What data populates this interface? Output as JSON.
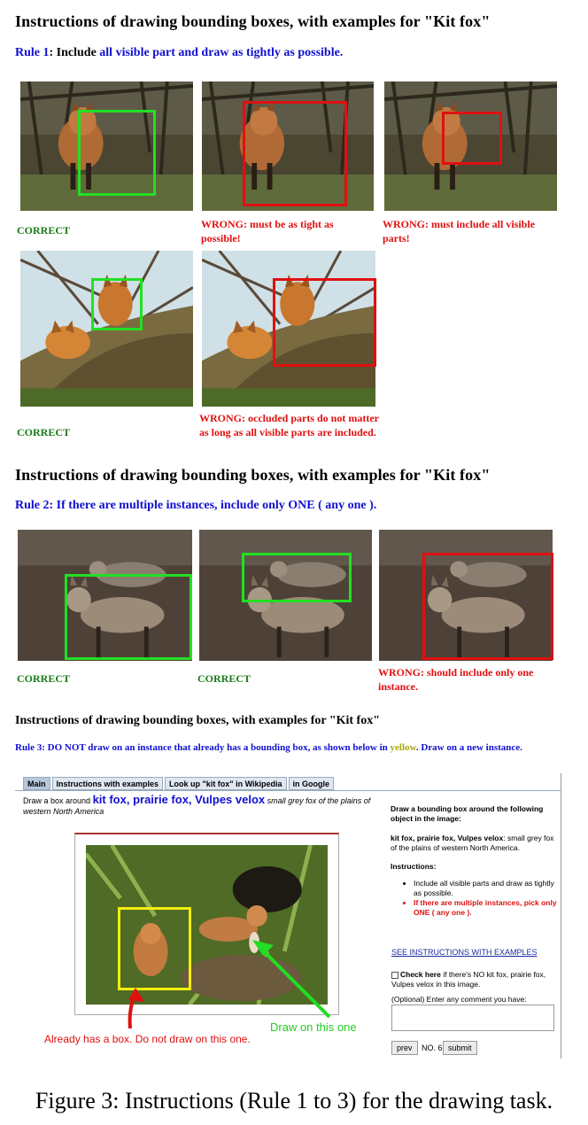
{
  "section1": {
    "heading": "Instructions of drawing bounding boxes, with examples for \"Kit fox\"",
    "rule_a": "Rule 1",
    "rule_b": ": Include ",
    "rule_c": "all visible part",
    "rule_d": " and draw ",
    "rule_e": "as tightly",
    "rule_f": " as possible.",
    "labels": {
      "correct_1": "CORRECT",
      "wrong_tight": "WRONG: must be as tight as possible!",
      "wrong_visible": "WRONG: must include all visible parts!",
      "correct_2": "CORRECT",
      "wrong_occluded": "WRONG: occluded parts do not matter as long as all visible parts are included."
    }
  },
  "section2": {
    "heading": "Instructions of drawing bounding boxes, with examples for \"Kit fox\"",
    "rule_a": "Rule 2",
    "rule_b": ": If there are ",
    "rule_c": "multiple",
    "rule_d": " instances, include ",
    "rule_e": "only ONE",
    "rule_f": " ( ",
    "rule_g": "any one",
    "rule_h": " ).",
    "labels": {
      "correct_1": "CORRECT",
      "correct_2": "CORRECT",
      "wrong_one": "WRONG: should include only one instance."
    }
  },
  "section3": {
    "heading": "Instructions of drawing bounding boxes, with examples for \"Kit fox\"",
    "rule_a": "Rule 3: DO NOT draw on an instance that already has a bounding box, as shown below in ",
    "rule_yellow": "yellow",
    "rule_b": ". Draw on a new instance.",
    "tabs": [
      "Main",
      "Instructions with examples",
      "Look up \"kit fox\" in Wikipedia",
      "in Google"
    ],
    "task_prefix": "Draw a box around",
    "task_names": "kit fox, prairie fox, Vulpes velox",
    "task_desc": "small grey fox of the plains of western North America",
    "side_title": "Draw a bounding box around the following object in the image:",
    "side_names": "kit fox, prairie fox, Vulpes velox",
    "side_desc": ": small grey fox of the plains of western North America.",
    "instructions_title": "Instructions:",
    "instruction_1": "Include all visible parts and draw as tightly as possible.",
    "instruction_2": "If there are multiple instances, pick only ONE ( any one ).",
    "see_link": "SEE INSTRUCTIONS WITH EXAMPLES",
    "check_bold": "Check here",
    "check_text": " if there's NO kit fox, prairie fox, Vulpes velox in this image.",
    "comment_label": "(Optional) Enter any comment you have:",
    "prev_label": "prev",
    "counter": "NO. 6",
    "submit_label": "submit",
    "note_green": "Draw on this one",
    "note_red": "Already has a box. Do not draw on this one."
  },
  "caption": "Figure 3: Instructions (Rule 1 to 3) for the drawing task.",
  "colors": {
    "rule_blue": "#1010d0",
    "correct_green": "#1a7a1a",
    "wrong_red": "#e01010",
    "box_green": "#22e022",
    "box_yellow": "#f2ee10"
  }
}
